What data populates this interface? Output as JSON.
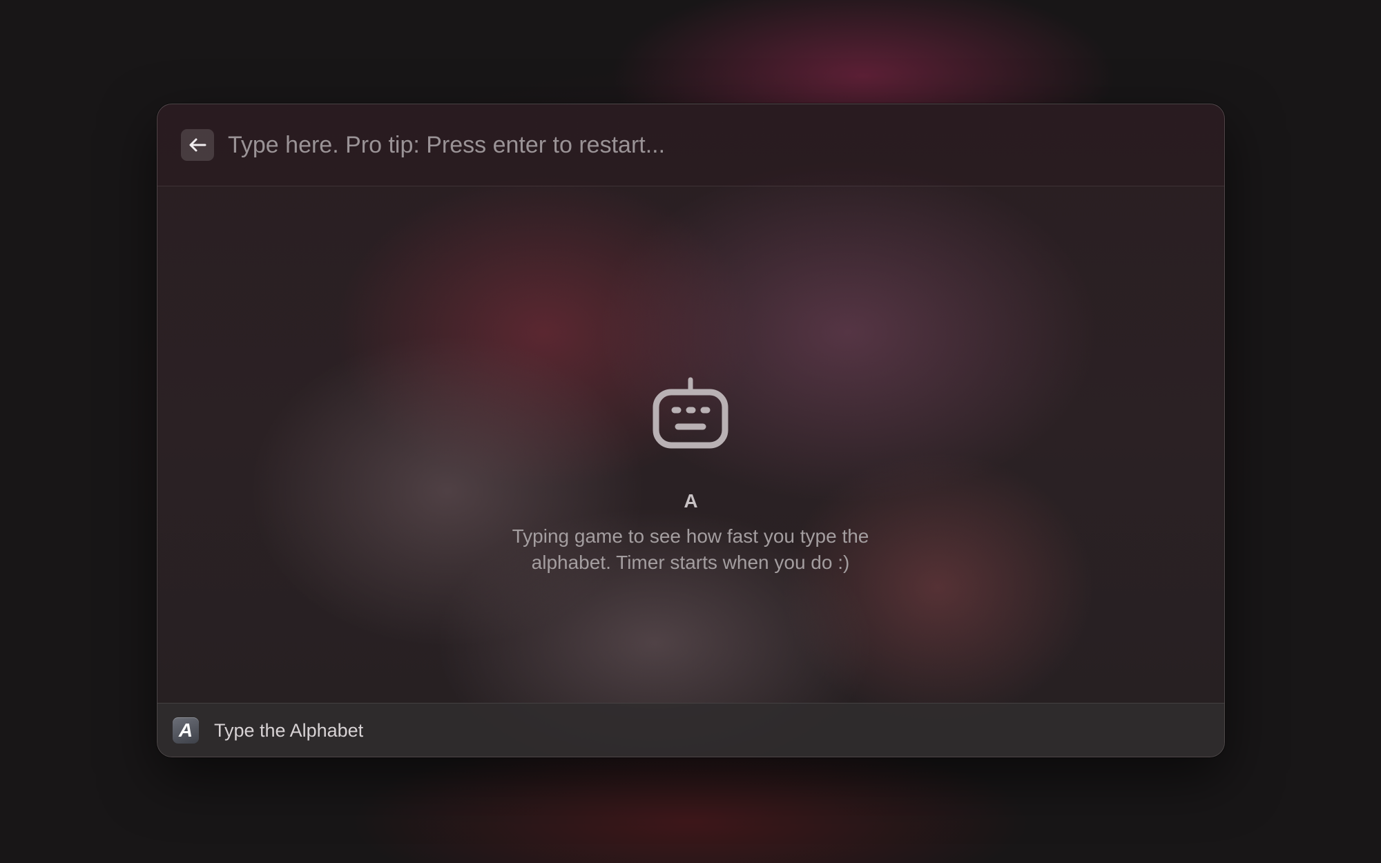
{
  "header": {
    "back_icon": "arrow-left-icon",
    "search_placeholder": "Type here. Pro tip: Press enter to restart...",
    "search_value": ""
  },
  "empty_state": {
    "icon": "robot-icon",
    "title": "A",
    "description": "Typing game to see how fast you type the alphabet. Timer starts when you do :)"
  },
  "footer": {
    "app_icon_glyph": "A",
    "app_name": "Type the Alphabet"
  },
  "colors": {
    "icon_tint": "#b9b1b4",
    "text_primary": "#c8c2c4",
    "text_secondary": "#a49ea0"
  }
}
